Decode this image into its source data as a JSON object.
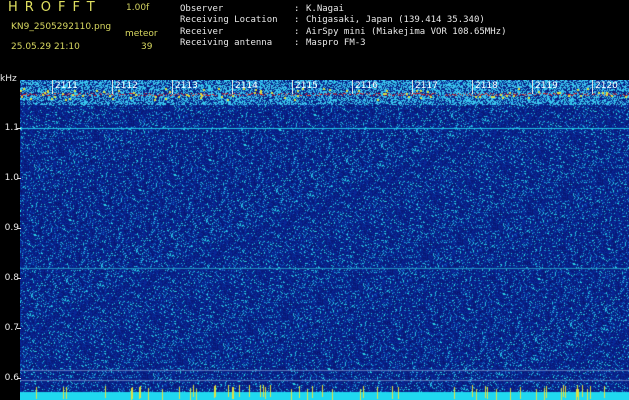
{
  "header": {
    "app_title": "HROFFT",
    "version": "1.00f",
    "filename": "KN9_2505292110.png",
    "datetime": "25.05.29 21:10",
    "meteor_label": "meteor",
    "meteor_count": "39"
  },
  "info": [
    {
      "key": "Observer",
      "value": "K.Nagai"
    },
    {
      "key": "Receiving Location",
      "value": "Chigasaki, Japan (139.414 35.340)"
    },
    {
      "key": "Receiver",
      "value": "AirSpy mini (Miakejima VOR 108.65MHz)"
    },
    {
      "key": "Receiving antenna",
      "value": "Maspro FM-3"
    }
  ],
  "spectrogram": {
    "y_unit": "kHz",
    "y_ticks": [
      "1.1",
      "1.0",
      "0.9",
      "0.8",
      "0.7",
      "0.6"
    ],
    "x_ticks": [
      "2111",
      "2112",
      "2113",
      "2114",
      "2115",
      "2116",
      "2117",
      "2118",
      "2119",
      "2120"
    ],
    "colors": {
      "background": "#0a1a8c",
      "noise_high": "#20e0ff",
      "signal": "#e02020",
      "baseline": "#20e0ff"
    }
  }
}
